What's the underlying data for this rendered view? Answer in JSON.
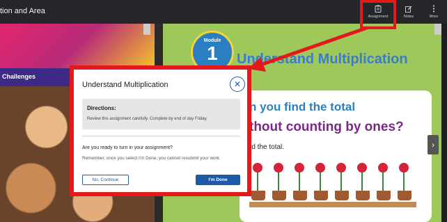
{
  "topbar": {
    "title": "tion and Area",
    "assignment_label": "Assignment",
    "notes_label": "Notes",
    "more_label": "More"
  },
  "book": {
    "left_band_text": "Challenges",
    "module_label": "Module",
    "module_number": "1",
    "module_title": "Understand Multiplication",
    "question_line1": "n you find the total",
    "question_line2": "thout counting by ones?",
    "question_line3": "rd the total.",
    "next_arrow": "›"
  },
  "modal": {
    "title": "Understand Multiplication",
    "close_symbol": "✕",
    "directions_heading": "Directions:",
    "directions_text": "Review this assignment carefully. Complete by end of day Friday.",
    "question": "Are you ready to turn in your assignment?",
    "warning": "Remember, once you select I'm Done, you cannot resubmit your work.",
    "no_button": "No, Continue",
    "done_button": "I'm Done"
  },
  "colors": {
    "highlight": "#e3191b",
    "primary": "#1e5aa8",
    "topbar": "#24262b"
  }
}
